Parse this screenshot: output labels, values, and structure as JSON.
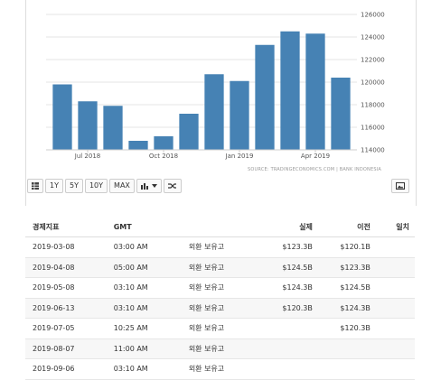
{
  "chart_data": {
    "type": "bar",
    "categories": [
      "2018-06",
      "2018-07",
      "2018-08",
      "2018-09",
      "2018-10",
      "2018-11",
      "2018-12",
      "2019-01",
      "2019-02",
      "2019-03",
      "2019-04",
      "2019-05"
    ],
    "values": [
      119.8,
      118.3,
      117.9,
      114.8,
      115.2,
      117.2,
      120.7,
      120.1,
      123.3,
      124.5,
      124.3,
      120.4
    ],
    "x_tick_labels": [
      {
        "label": "Jul 2018",
        "category": "2018-07"
      },
      {
        "label": "Oct 2018",
        "category": "2018-10"
      },
      {
        "label": "Jan 2019",
        "category": "2019-01"
      },
      {
        "label": "Apr 2019",
        "category": "2019-04"
      }
    ],
    "y_ticks": [
      "114000",
      "116000",
      "118000",
      "120000",
      "122000",
      "124000",
      "126000"
    ],
    "y_tick_values": [
      114,
      116,
      118,
      120,
      122,
      124,
      126
    ],
    "ylim": [
      114,
      126
    ],
    "grid": true,
    "bar_color": "#4682b4",
    "source": "SOURCE: TRADINGECONOMICS.COM  |  BANK INDONESIA"
  },
  "toolbar": {
    "buttons": [
      "1Y",
      "5Y",
      "10Y",
      "MAX"
    ]
  },
  "table": {
    "headers": {
      "date": "경제지표",
      "time": "GMT",
      "event": "",
      "actual": "실제",
      "previous": "이전",
      "forecast": "일치"
    },
    "rows": [
      {
        "date": "2019-03-08",
        "time": "03:00 AM",
        "event": "외환 보유고",
        "actual": "$123.3B",
        "previous": "$120.1B",
        "forecast": ""
      },
      {
        "date": "2019-04-08",
        "time": "05:00 AM",
        "event": "외환 보유고",
        "actual": "$124.5B",
        "previous": "$123.3B",
        "forecast": ""
      },
      {
        "date": "2019-05-08",
        "time": "03:10 AM",
        "event": "외환 보유고",
        "actual": "$124.3B",
        "previous": "$124.5B",
        "forecast": ""
      },
      {
        "date": "2019-06-13",
        "time": "03:10 AM",
        "event": "외환 보유고",
        "actual": "$120.3B",
        "previous": "$124.3B",
        "forecast": ""
      },
      {
        "date": "2019-07-05",
        "time": "10:25 AM",
        "event": "외환 보유고",
        "actual": "",
        "previous": "$120.3B",
        "forecast": ""
      },
      {
        "date": "2019-08-07",
        "time": "11:00 AM",
        "event": "외환 보유고",
        "actual": "",
        "previous": "",
        "forecast": ""
      },
      {
        "date": "2019-09-06",
        "time": "03:10 AM",
        "event": "외환 보유고",
        "actual": "",
        "previous": "",
        "forecast": ""
      }
    ]
  }
}
